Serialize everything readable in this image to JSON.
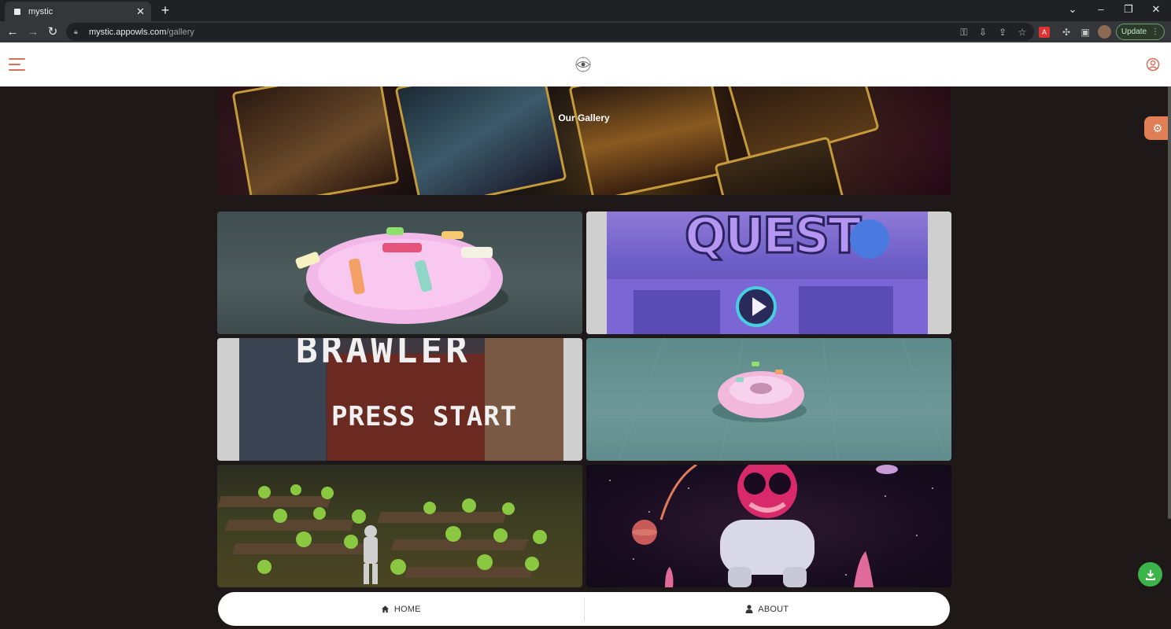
{
  "browser": {
    "tab_title": "mystic",
    "url_host": "mystic.appowls.com",
    "url_path": "/gallery",
    "update_label": "Update"
  },
  "site": {
    "hero_title": "Our Gallery"
  },
  "gallery": {
    "items": [
      {
        "name": "pink-donut-render"
      },
      {
        "name": "quest-game-title"
      },
      {
        "name": "brawler-press-start"
      },
      {
        "name": "donut-on-grid"
      },
      {
        "name": "garden-robot-scene"
      },
      {
        "name": "astronaut-space"
      }
    ],
    "image_text": {
      "quest_word": "QUEST",
      "brawler_word": "BRAWLER",
      "press_start": "PRESS START"
    }
  },
  "bottom_nav": {
    "home_label": "HOME",
    "about_label": "ABOUT"
  },
  "colors": {
    "accent": "#d9705a",
    "settings_tab": "#e07f55",
    "download_fab": "#3bb54a",
    "page_bg": "#1f1819"
  },
  "icons": {
    "menu": "hamburger-icon",
    "logo": "eye-logo-icon",
    "user": "user-circle-icon",
    "settings": "gear-icon",
    "download": "download-icon",
    "home": "home-icon",
    "about": "user-icon"
  }
}
